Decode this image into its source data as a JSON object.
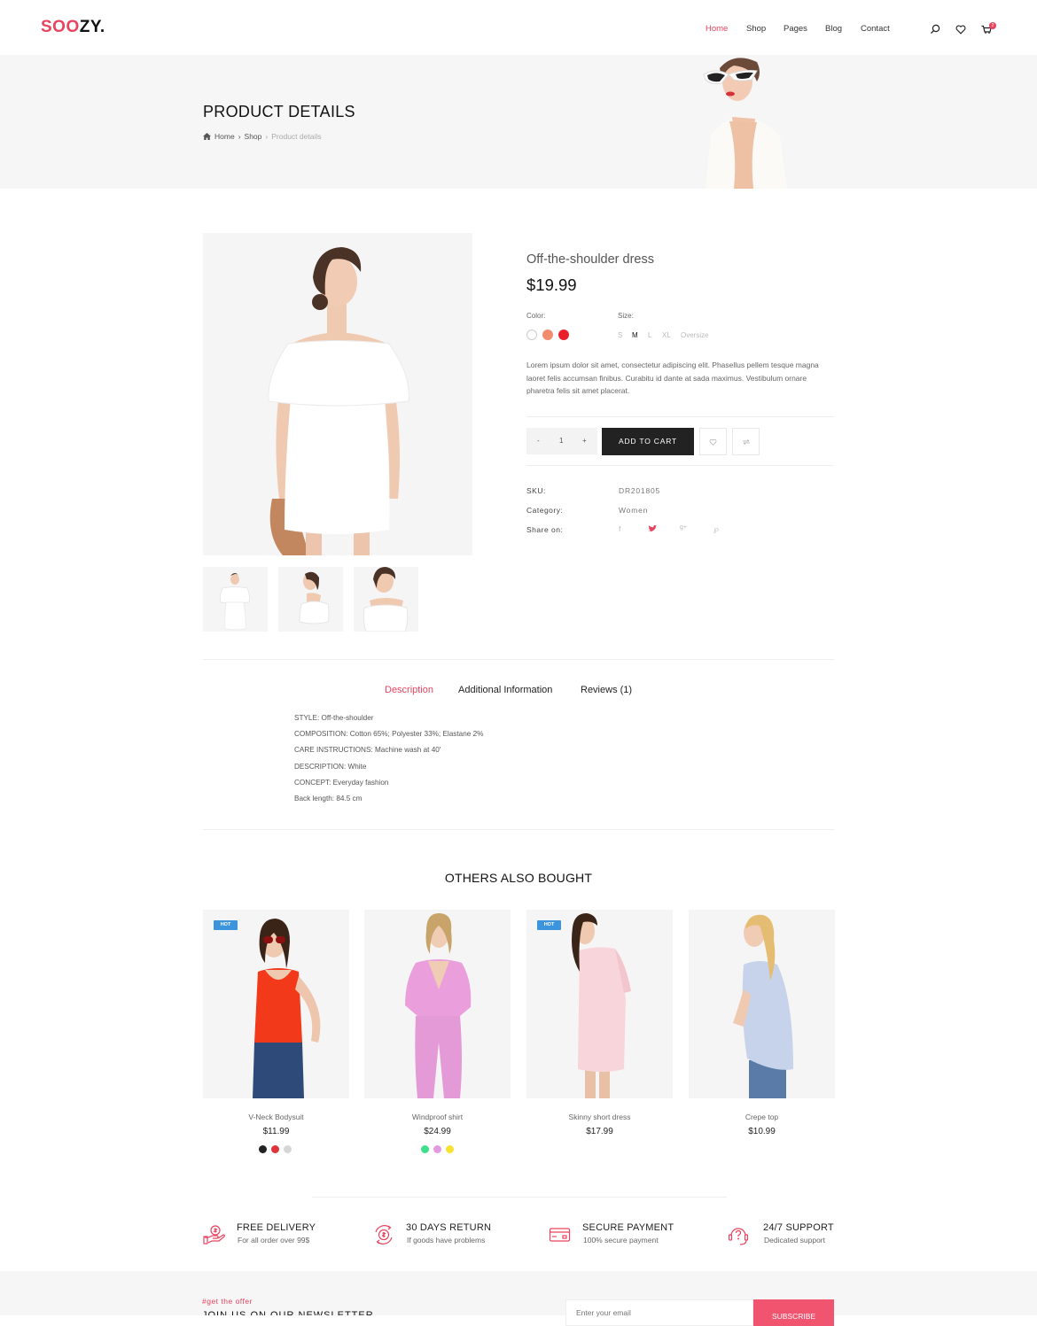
{
  "brand": {
    "logo_accent": "SOO",
    "logo_rest": "ZY.",
    "accent_color": "#e8435f"
  },
  "nav": {
    "items": [
      {
        "label": "Home",
        "active": true
      },
      {
        "label": "Shop",
        "active": false
      },
      {
        "label": "Pages",
        "active": false
      },
      {
        "label": "Blog",
        "active": false
      },
      {
        "label": "Contact",
        "active": false
      }
    ],
    "icons": [
      "search-icon",
      "heart-icon",
      "cart-icon"
    ],
    "cart_count": "2"
  },
  "hero": {
    "title": "PRODUCT DETAILS",
    "breadcrumb": [
      "Home",
      "Shop",
      "Product details"
    ]
  },
  "product": {
    "name": "Off-the-shoulder dress",
    "price": "$19.99",
    "color_label": "Color:",
    "colors": [
      "#ffffff",
      "#f28c6e",
      "#e8202a"
    ],
    "size_label": "Size:",
    "sizes": [
      "S",
      "M",
      "L",
      "XL",
      "Oversize"
    ],
    "selected_size": "M",
    "description": "Lorem ipsum dolor sit amet, consectetur adipiscing elit. Phasellus pellem tesque magna laoret felis accumsan finibus. Curabitu id dante at sada maximus. Vestibulum ornare pharetra felis sit amet placerat.",
    "quantity": {
      "minus": "-",
      "value": "1",
      "plus": "+"
    },
    "add_to_cart": "ADD TO CART",
    "meta": {
      "sku_label": "SKU:",
      "sku": "DR201805",
      "category_label": "Category:",
      "category": "Women",
      "share_label": "Share on:"
    },
    "share_icons": [
      "facebook-icon",
      "twitter-icon",
      "google-plus-icon",
      "pinterest-icon"
    ],
    "thumbnails": 3
  },
  "tabs": {
    "items": [
      {
        "label": "Description",
        "active": true
      },
      {
        "label": "Additional Information",
        "active": false
      },
      {
        "label": "Reviews (1)",
        "active": false
      }
    ],
    "description_lines": [
      "STYLE: Off-the-shoulder",
      "COMPOSITION: Cotton 65%; Polyester 33%; Elastane 2%",
      "CARE INSTRUCTIONS: Machine wash at 40'",
      "DESCRIPTION: White",
      "CONCEPT: Everyday fashion",
      "Back length: 84.5 cm"
    ]
  },
  "others": {
    "title": "OTHERS ALSO BOUGHT",
    "products": [
      {
        "name": "V-Neck Bodysuit",
        "price": "$11.99",
        "badge": "HOT",
        "colors": [
          "#222222",
          "#e0343a",
          "#d6d6d6"
        ]
      },
      {
        "name": "Windproof shirt",
        "price": "$24.99",
        "badge": "",
        "colors": [
          "#3ee08f",
          "#e29be0",
          "#f7e234"
        ]
      },
      {
        "name": "Skinny short dress",
        "price": "$17.99",
        "badge": "HOT",
        "colors": []
      },
      {
        "name": "Crepe top",
        "price": "$10.99",
        "badge": "",
        "colors": []
      }
    ]
  },
  "features": [
    {
      "title": "FREE DELIVERY",
      "subtitle": "For all order over 99$",
      "icon": "hand-money-icon"
    },
    {
      "title": "30 DAYS RETURN",
      "subtitle": "If goods have problems",
      "icon": "money-return-icon"
    },
    {
      "title": "SECURE PAYMENT",
      "subtitle": "100% secure payment",
      "icon": "credit-card-icon"
    },
    {
      "title": "24/7 SUPPORT",
      "subtitle": "Dedicated support",
      "icon": "headset-support-icon"
    }
  ],
  "newsletter": {
    "tag": "#get the offer",
    "heading": "JOIN US ON OUR NEWSLETTER",
    "placeholder": "Enter your email",
    "button": "SUBSCRIBE"
  }
}
